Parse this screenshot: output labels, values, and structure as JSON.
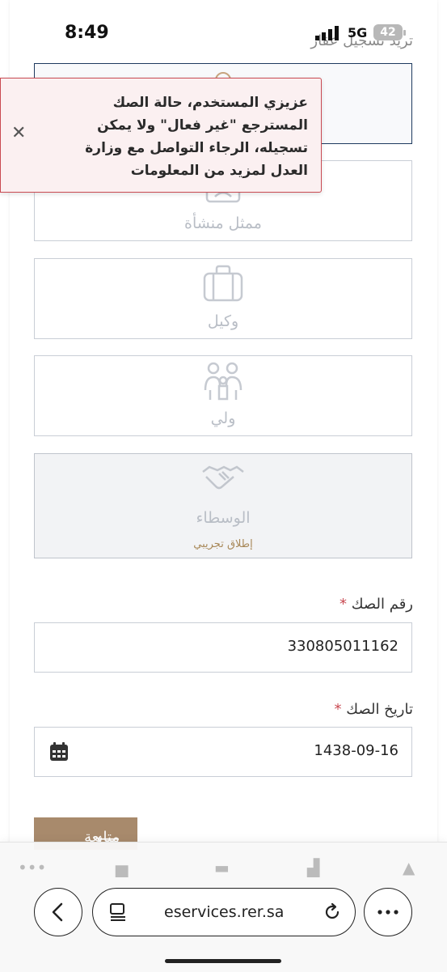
{
  "status_bar": {
    "time": "8:49",
    "network": "5G",
    "battery": "42"
  },
  "page_heading": "تريد تسجيل عقار",
  "alert": {
    "message": "عزيزي المستخدم، حالة الصك المسترجع \"غير فعال\" ولا يمكن تسجيله، الرجاء التواصل مع وزارة العدل لمزيد من المعلومات",
    "close_icon": "close-icon"
  },
  "options": [
    {
      "label": "ممثل منشأة",
      "icon": "id-card-icon"
    },
    {
      "label": "وكيل",
      "icon": "briefcase-icon"
    },
    {
      "label": "ولي",
      "icon": "family-icon"
    },
    {
      "label": "الوسطاء",
      "icon": "handshake-icon",
      "badge": "إطلاق تجريبي"
    }
  ],
  "deed_number": {
    "label": "رقم الصك",
    "required_mark": "*",
    "value": "330805011162"
  },
  "deed_date": {
    "label": "تاريخ الصك",
    "required_mark": "*",
    "value": "1438-09-16",
    "icon": "calendar-icon"
  },
  "next_button": {
    "label": "متابعة"
  },
  "browser": {
    "url": "eservices.rer.sa"
  },
  "colors": {
    "accent": "#a88a6c",
    "alert_border": "#c94a52",
    "selected_border": "#1e3a5f"
  }
}
